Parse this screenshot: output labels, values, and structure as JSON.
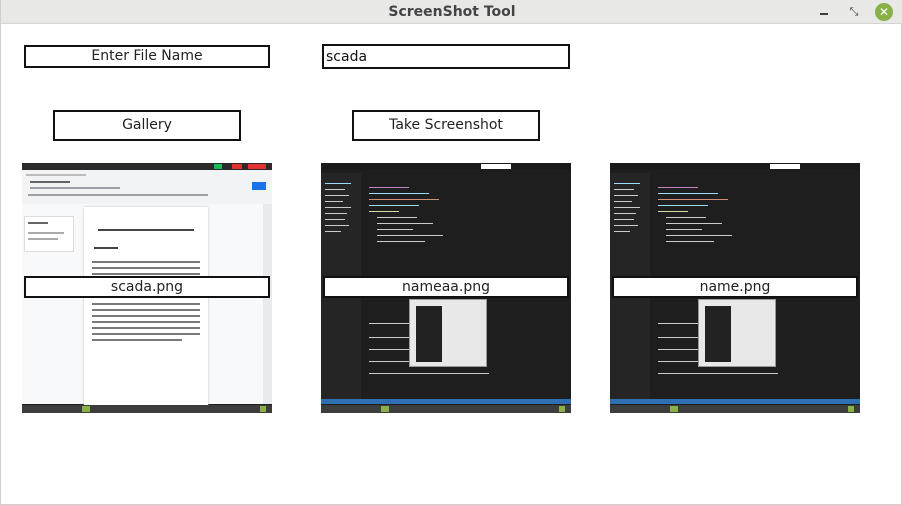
{
  "window": {
    "title": "ScreenShot Tool",
    "controls": {
      "minimize": "minimize",
      "maximize": "maximize",
      "close": "close"
    }
  },
  "form": {
    "file_name_label": "Enter File Name",
    "file_name_value": "scada"
  },
  "buttons": {
    "gallery": "Gallery",
    "take_screenshot": "Take Screenshot"
  },
  "thumbnails": [
    {
      "name": "scada.png"
    },
    {
      "name": "nameaa.png"
    },
    {
      "name": "name.png"
    }
  ],
  "colors": {
    "close_button": "#8ab04a",
    "titlebar": "#e8e8e7"
  }
}
